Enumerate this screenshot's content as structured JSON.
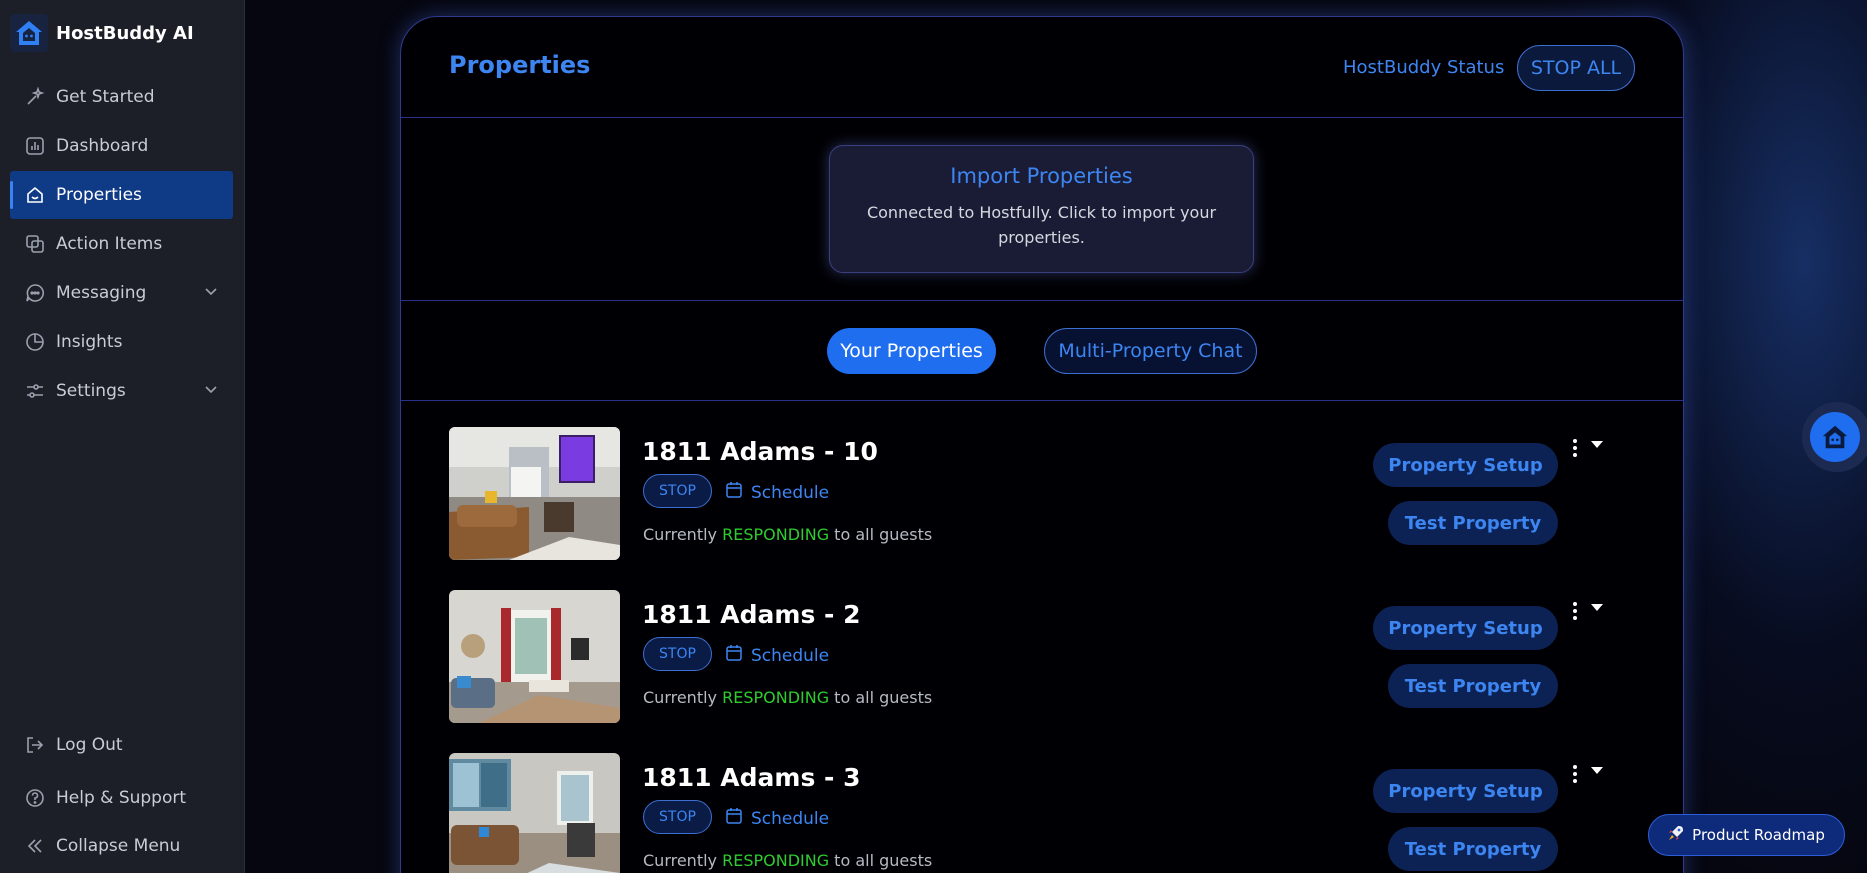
{
  "brand": {
    "name": "HostBuddy AI"
  },
  "sidebar": {
    "items": [
      {
        "label": "Get Started",
        "icon": "sparkle-icon"
      },
      {
        "label": "Dashboard",
        "icon": "chart-icon"
      },
      {
        "label": "Properties",
        "icon": "home-icon",
        "active": true
      },
      {
        "label": "Action Items",
        "icon": "copy-icon"
      },
      {
        "label": "Messaging",
        "icon": "chat-icon",
        "expandable": true
      },
      {
        "label": "Insights",
        "icon": "pie-icon"
      },
      {
        "label": "Settings",
        "icon": "sliders-icon",
        "expandable": true
      }
    ],
    "bottom": [
      {
        "label": "Log Out",
        "icon": "logout-icon"
      },
      {
        "label": "Help & Support",
        "icon": "help-icon"
      },
      {
        "label": "Collapse Menu",
        "icon": "collapse-icon"
      }
    ]
  },
  "header": {
    "title": "Properties",
    "status_label": "HostBuddy Status",
    "stop_all_label": "STOP ALL"
  },
  "import": {
    "title": "Import Properties",
    "description": "Connected to Hostfully. Click to import your properties."
  },
  "tabs": {
    "your_properties": "Your Properties",
    "multi_chat": "Multi-Property Chat"
  },
  "properties": [
    {
      "name": "1811 Adams - 10",
      "stop_label": "STOP",
      "schedule_label": "Schedule",
      "status_prefix": "Currently ",
      "status_word": "RESPONDING",
      "status_suffix": " to all guests",
      "setup_label": "Property Setup",
      "test_label": "Test Property"
    },
    {
      "name": "1811 Adams - 2",
      "stop_label": "STOP",
      "schedule_label": "Schedule",
      "status_prefix": "Currently ",
      "status_word": "RESPONDING",
      "status_suffix": " to all guests",
      "setup_label": "Property Setup",
      "test_label": "Test Property"
    },
    {
      "name": "1811 Adams - 3",
      "stop_label": "STOP",
      "schedule_label": "Schedule",
      "status_prefix": "Currently ",
      "status_word": "RESPONDING",
      "status_suffix": " to all guests",
      "setup_label": "Property Setup",
      "test_label": "Test Property"
    }
  ],
  "roadmap": {
    "label": "Product Roadmap",
    "icon": "rocket-icon"
  },
  "colors": {
    "accent": "#3d86f2",
    "active_nav": "#0f3a86",
    "responding": "#2ecc2e",
    "sidebar_bg": "#1c1f27",
    "panel_bg": "#000004"
  }
}
